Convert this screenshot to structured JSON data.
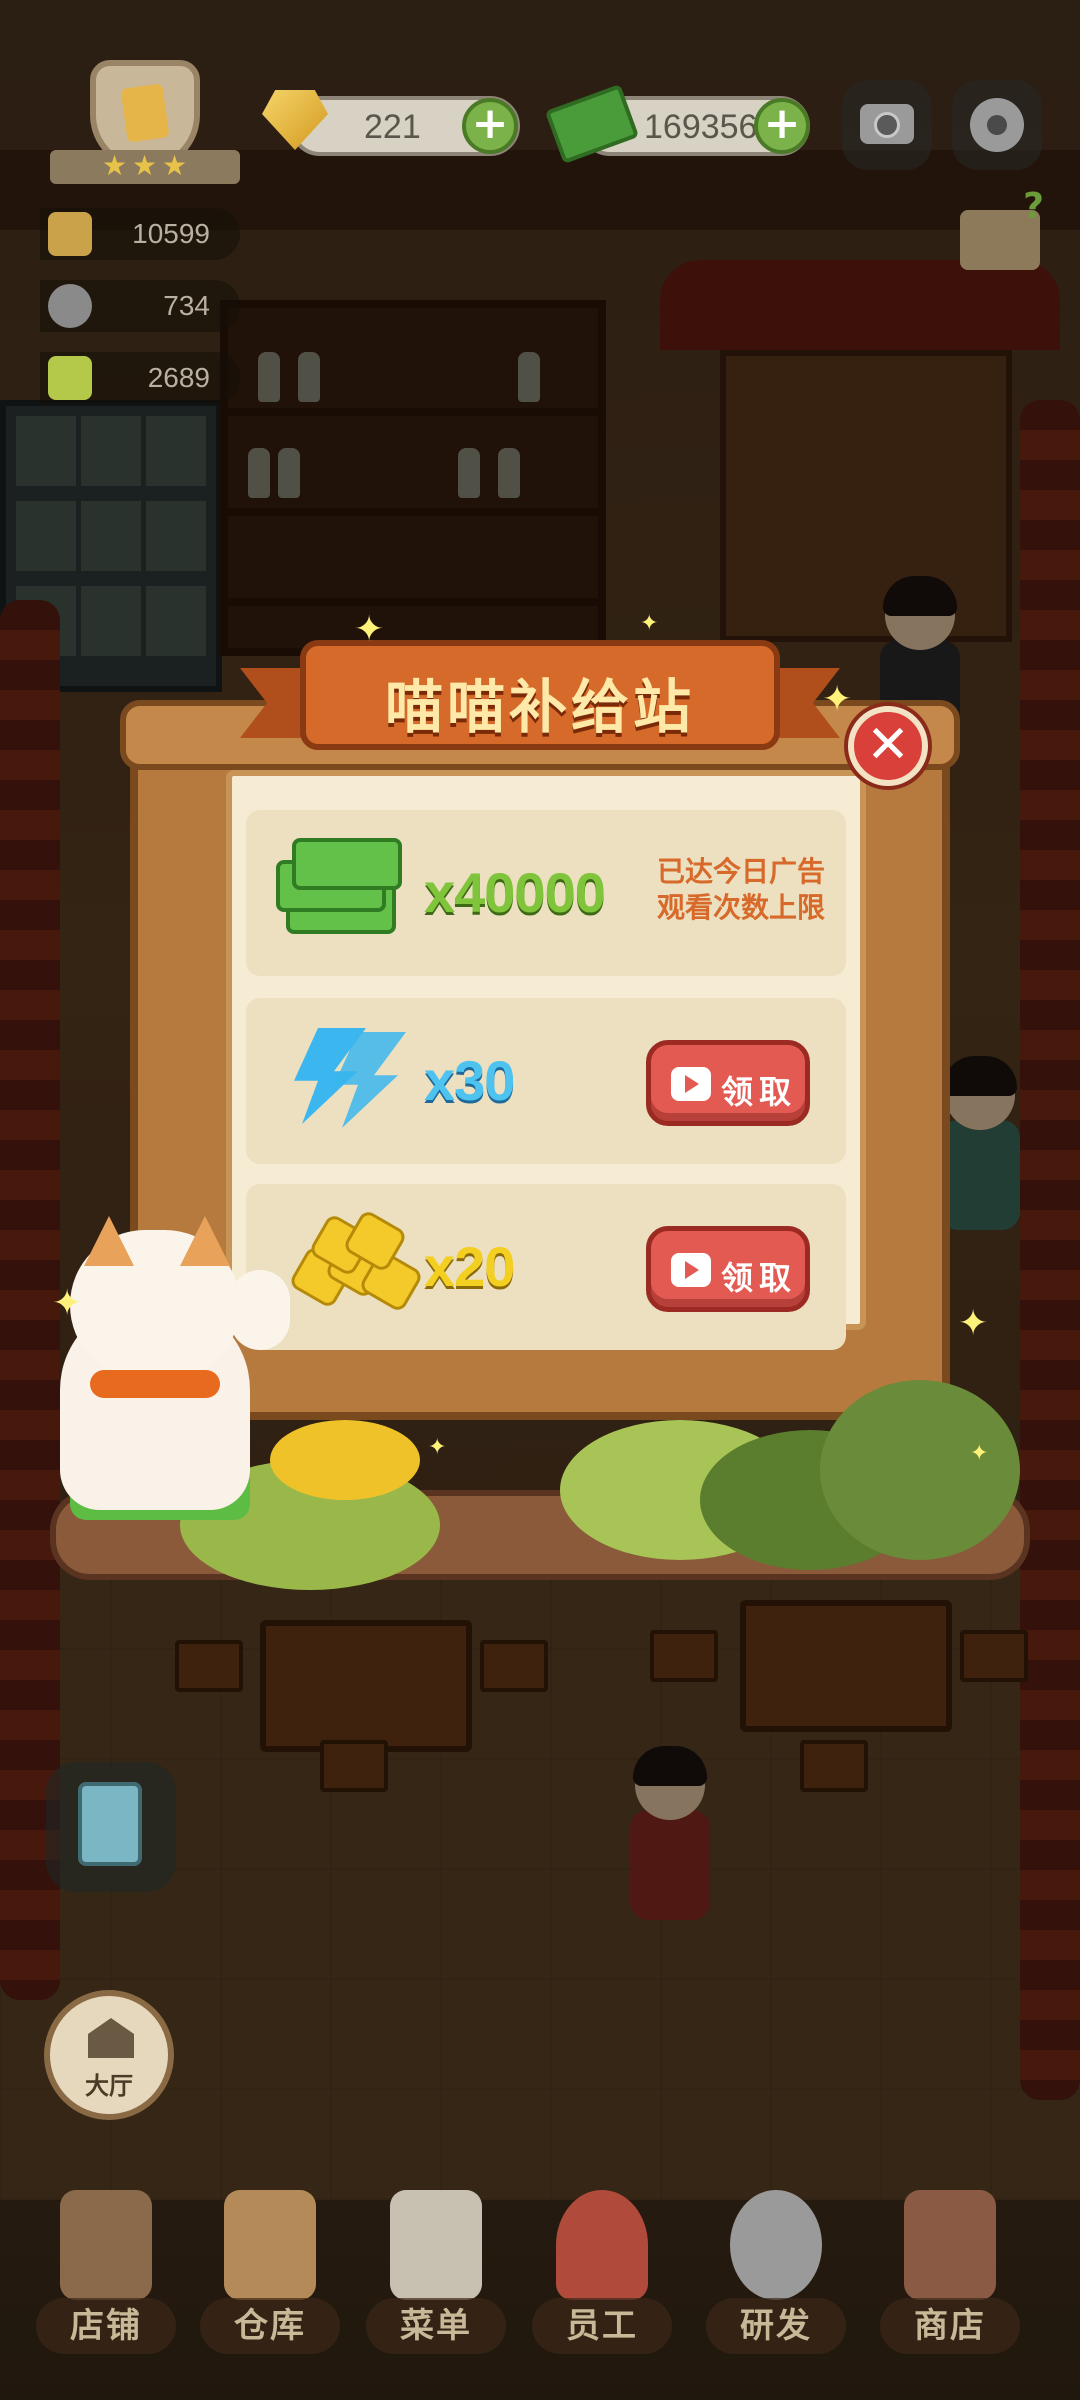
{
  "hud": {
    "gems": "221",
    "cash": "169356",
    "stats": [
      "10599",
      "734",
      "2689"
    ],
    "rank_stars": 3
  },
  "popup": {
    "title": "喵喵补给站",
    "rewards": [
      {
        "icon": "cash-stack-icon",
        "qty": "x40000",
        "status": "已达今日广告观看次数上限",
        "status_lines": [
          "已达今日广告",
          "观看次数上限"
        ],
        "color": "#7fc43a"
      },
      {
        "icon": "lightning-icon",
        "qty": "x30",
        "button": "领取",
        "color": "#4ec3ef"
      },
      {
        "icon": "gold-nuggets-icon",
        "qty": "x20",
        "button": "领取",
        "color": "#f3cf22"
      }
    ]
  },
  "side": {
    "hall_label": "大厅"
  },
  "nav": {
    "items": [
      "店铺",
      "仓库",
      "菜单",
      "员工",
      "研发",
      "商店"
    ]
  },
  "colors": {
    "close_button": "#d9403a",
    "claim_button": "#e35a52",
    "banner": "#d66a2a"
  }
}
